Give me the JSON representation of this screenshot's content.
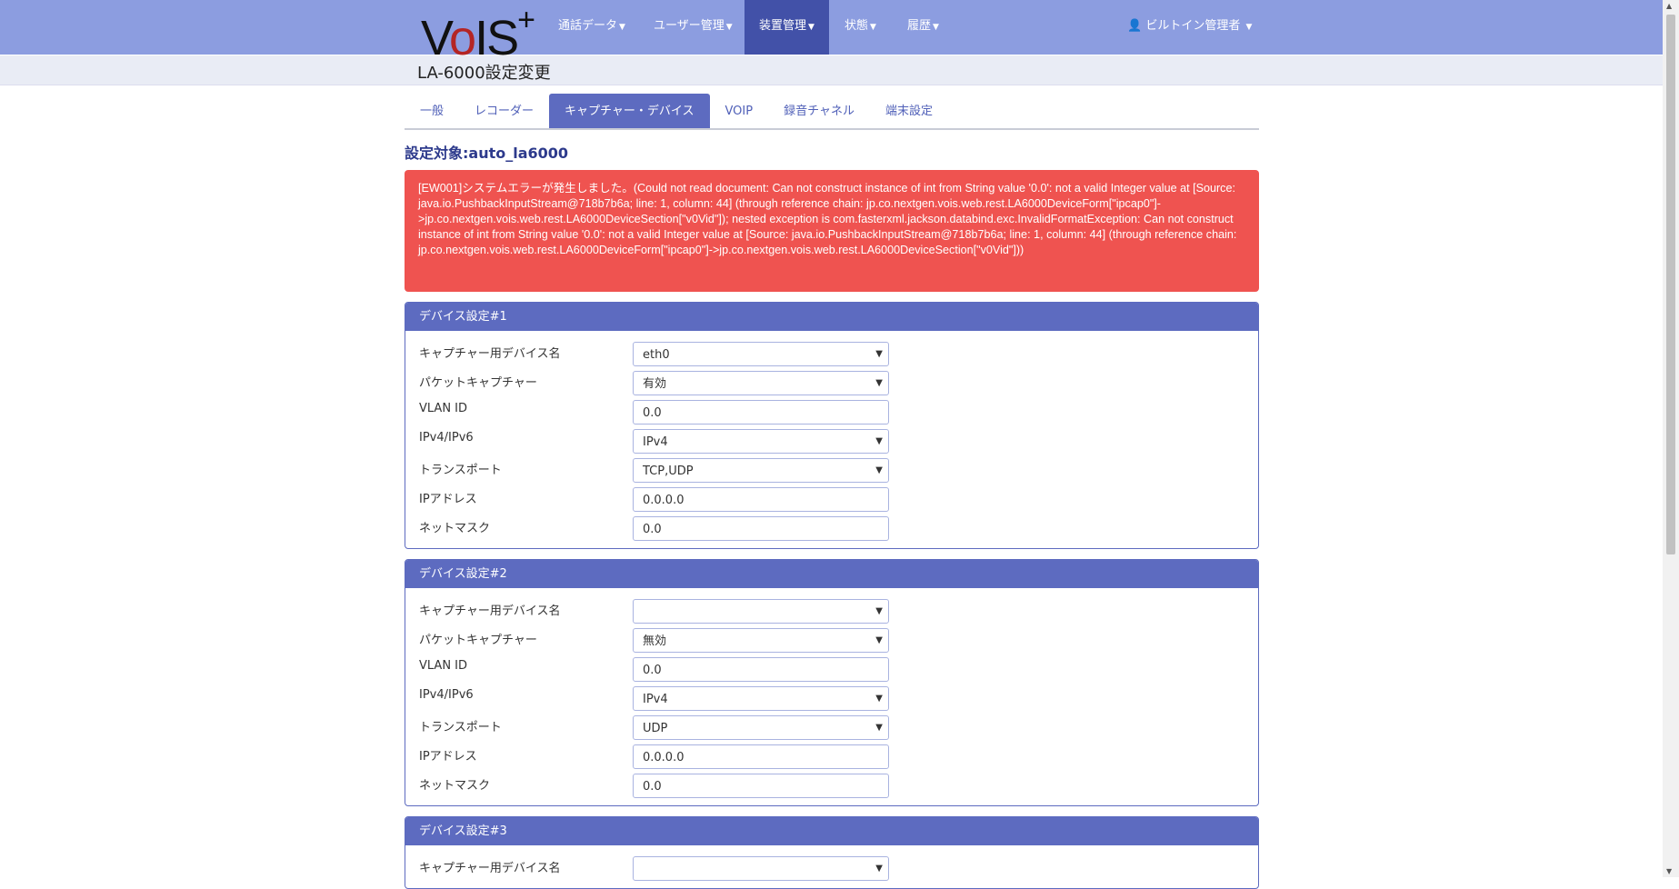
{
  "navbar": {
    "logo": "VoIS+",
    "items": [
      "通話データ",
      "ユーザー管理",
      "装置管理",
      "状態",
      "履歴"
    ],
    "active": 2,
    "user": "ビルトイン管理者"
  },
  "page": {
    "title": "LA-6000設定変更",
    "target": "設定対象:auto_la6000"
  },
  "tabs": [
    "一般",
    "レコーダー",
    "キャプチャー・デバイス",
    "VOIP",
    "録音チャネル",
    "端末設定"
  ],
  "active_tab": 2,
  "error": "[EW001]システムエラーが発生しました。(Could not read document: Can not construct instance of int from String value '0.0': not a valid Integer value at [Source: java.io.PushbackInputStream@718b7b6a; line: 1, column: 44] (through reference chain: jp.co.nextgen.vois.web.rest.LA6000DeviceForm[\"ipcap0\"]->jp.co.nextgen.vois.web.rest.LA6000DeviceSection[\"v0Vid\"]); nested exception is com.fasterxml.jackson.databind.exc.InvalidFormatException: Can not construct instance of int from String value '0.0': not a valid Integer value at [Source: java.io.PushbackInputStream@718b7b6a; line: 1, column: 44] (through reference chain: jp.co.nextgen.vois.web.rest.LA6000DeviceForm[\"ipcap0\"]->jp.co.nextgen.vois.web.rest.LA6000DeviceSection[\"v0Vid\"]))",
  "panels": [
    {
      "title": "デバイス設定#1",
      "rows": [
        {
          "label": "キャプチャー用デバイス名",
          "value": "eth0",
          "type": "select"
        },
        {
          "label": "パケットキャプチャー",
          "value": "有効",
          "type": "select"
        },
        {
          "label": "VLAN ID",
          "value": "0.0",
          "type": "input"
        },
        {
          "label": "IPv4/IPv6",
          "value": "IPv4",
          "type": "select"
        },
        {
          "label": "トランスポート",
          "value": "TCP,UDP",
          "type": "select"
        },
        {
          "label": "IPアドレス",
          "value": "0.0.0.0",
          "type": "input"
        },
        {
          "label": "ネットマスク",
          "value": "0.0",
          "type": "input"
        }
      ]
    },
    {
      "title": "デバイス設定#2",
      "rows": [
        {
          "label": "キャプチャー用デバイス名",
          "value": "",
          "type": "select"
        },
        {
          "label": "パケットキャプチャー",
          "value": "無効",
          "type": "select"
        },
        {
          "label": "VLAN ID",
          "value": "0.0",
          "type": "input"
        },
        {
          "label": "IPv4/IPv6",
          "value": "IPv4",
          "type": "select"
        },
        {
          "label": "トランスポート",
          "value": "UDP",
          "type": "select"
        },
        {
          "label": "IPアドレス",
          "value": "0.0.0.0",
          "type": "input"
        },
        {
          "label": "ネットマスク",
          "value": "0.0",
          "type": "input"
        }
      ]
    },
    {
      "title": "デバイス設定#3",
      "rows": [
        {
          "label": "キャプチャー用デバイス名",
          "value": "",
          "type": "select"
        }
      ]
    }
  ]
}
